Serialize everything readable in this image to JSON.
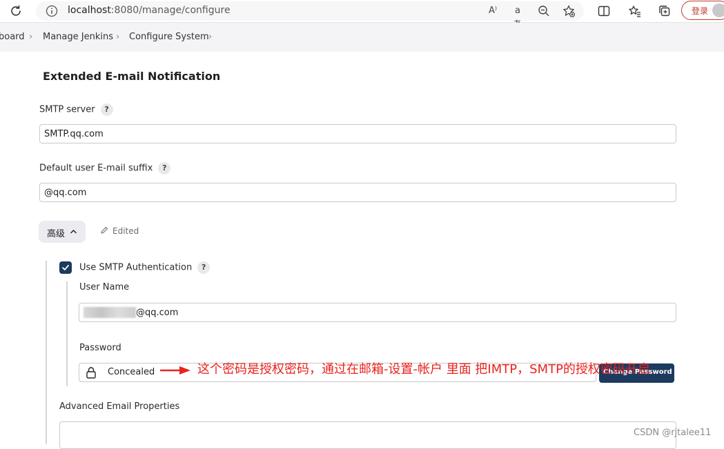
{
  "browser": {
    "url_host": "localhost",
    "url_path": ":8080/manage/configure",
    "read_aloud_glyph": "A⁾",
    "translate_glyph": "aあ",
    "login_label": "登录"
  },
  "breadcrumb": {
    "items": [
      "board",
      "Manage Jenkins",
      "Configure System"
    ],
    "separator": "›"
  },
  "section": {
    "title": "Extended E-mail Notification"
  },
  "smtp_server": {
    "label": "SMTP server",
    "help": "?",
    "value": "SMTP.qq.com"
  },
  "email_suffix": {
    "label": "Default user E-mail suffix",
    "help": "?",
    "value": "@qq.com"
  },
  "advanced": {
    "button_label": "高级",
    "edited_label": "Edited"
  },
  "smtp_auth": {
    "checkbox_label": "Use SMTP Authentication",
    "help": "?",
    "checked": true,
    "username_label": "User Name",
    "username_value": "@qq.com",
    "password_label": "Password",
    "password_value": "Concealed",
    "change_password_label": "Change Password"
  },
  "advanced_email_properties": {
    "label": "Advanced Email Properties"
  },
  "annotation": {
    "text": "这个密码是授权密码，通过在邮箱-设置-帐户 里面 把IMTP，SMTP的授权密码开启",
    "color": "#e8231d"
  },
  "watermark": "CSDN @rjtalee11",
  "colors": {
    "primary": "#1d3a5f",
    "login_red": "#c0392b"
  },
  "icons": [
    "reload-icon",
    "info-icon",
    "read-aloud-icon",
    "translate-icon",
    "zoom-out-icon",
    "add-favorite-icon",
    "split-screen-icon",
    "favorites-icon",
    "collections-icon",
    "chevron-up-icon",
    "pencil-icon",
    "check-icon",
    "lock-icon",
    "arrow-icon"
  ]
}
